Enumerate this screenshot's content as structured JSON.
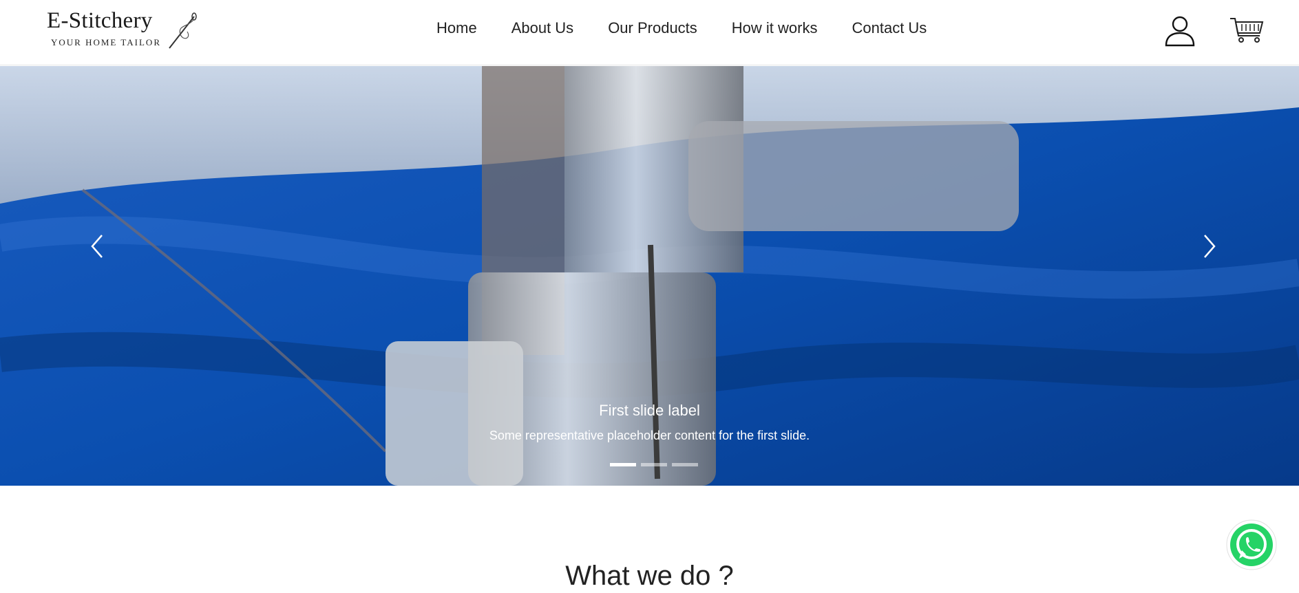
{
  "brand": {
    "title": "E-Stitchery",
    "tagline": "YOUR HOME TAILOR"
  },
  "nav": {
    "links": [
      {
        "label": "Home"
      },
      {
        "label": "About Us"
      },
      {
        "label": "Our Products"
      },
      {
        "label": "How it works"
      },
      {
        "label": "Contact Us"
      }
    ],
    "icons": [
      "user-icon",
      "cart-icon"
    ]
  },
  "carousel": {
    "caption_title": "First slide label",
    "caption_text": "Some representative placeholder content for the first slide.",
    "slide_count": 3,
    "active_slide": 1,
    "colors": {
      "fabric": "#0b4fb0",
      "fabric_dark": "#062f73",
      "metal": "#b9bcc0"
    }
  },
  "section": {
    "title": "What we do ?"
  },
  "floating": {
    "whatsapp_icon": "whatsapp-icon",
    "whatsapp_color": "#25d366"
  }
}
